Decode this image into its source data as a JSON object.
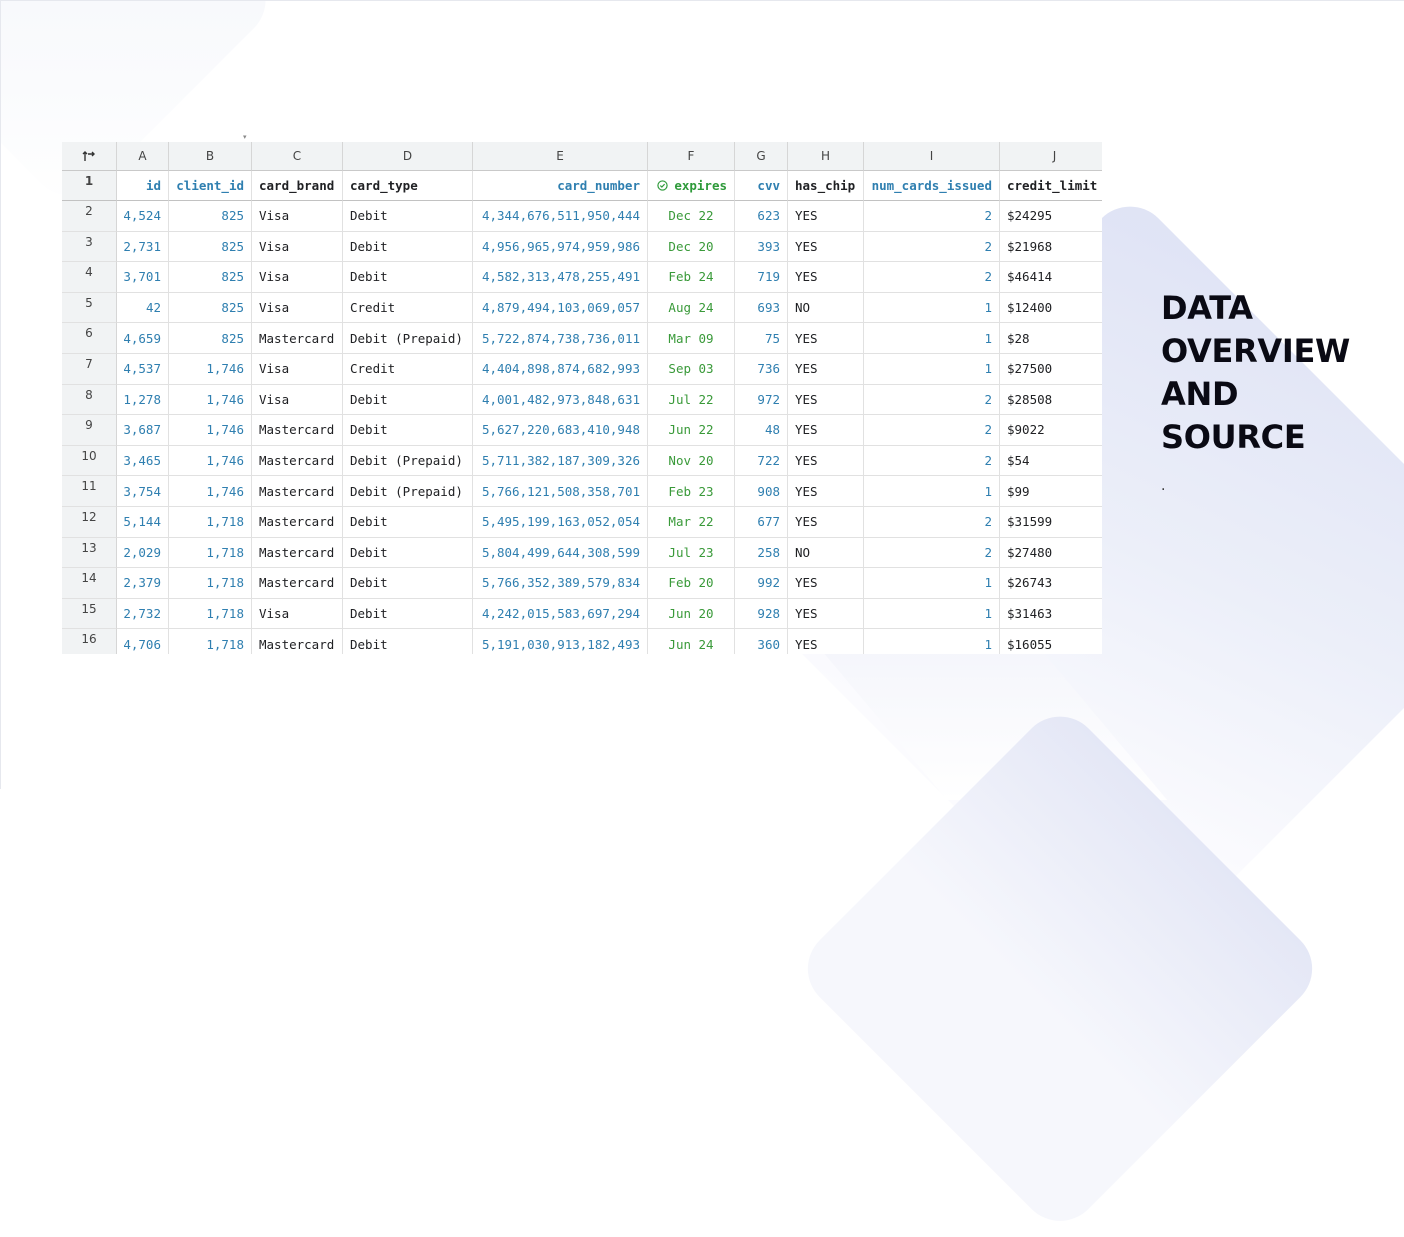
{
  "slide": {
    "title_lines": [
      "DATA",
      "OVERVIEW",
      "AND",
      "SOURCE"
    ],
    "subtitle": "."
  },
  "sheet": {
    "column_letters": [
      "A",
      "B",
      "C",
      "D",
      "E",
      "F",
      "G",
      "H",
      "I",
      "J"
    ],
    "field_names": [
      "id",
      "client_id",
      "card_brand",
      "card_type",
      "card_number",
      "expires",
      "cvv",
      "has_chip",
      "num_cards_issued",
      "credit_limit"
    ],
    "expires_icon": "clock-check-icon",
    "colors": {
      "number": "#2f7fb0",
      "date": "#3a9a3a",
      "text": "#202124",
      "header_bg": "#f1f3f4"
    },
    "rows": [
      {
        "n": "2",
        "id": "4,524",
        "client_id": "825",
        "card_brand": "Visa",
        "card_type": "Debit",
        "card_number": "4,344,676,511,950,444",
        "expires": "Dec 22",
        "cvv": "623",
        "has_chip": "YES",
        "num_cards_issued": "2",
        "credit_limit": "$24295"
      },
      {
        "n": "3",
        "id": "2,731",
        "client_id": "825",
        "card_brand": "Visa",
        "card_type": "Debit",
        "card_number": "4,956,965,974,959,986",
        "expires": "Dec 20",
        "cvv": "393",
        "has_chip": "YES",
        "num_cards_issued": "2",
        "credit_limit": "$21968"
      },
      {
        "n": "4",
        "id": "3,701",
        "client_id": "825",
        "card_brand": "Visa",
        "card_type": "Debit",
        "card_number": "4,582,313,478,255,491",
        "expires": "Feb 24",
        "cvv": "719",
        "has_chip": "YES",
        "num_cards_issued": "2",
        "credit_limit": "$46414"
      },
      {
        "n": "5",
        "id": "42",
        "client_id": "825",
        "card_brand": "Visa",
        "card_type": "Credit",
        "card_number": "4,879,494,103,069,057",
        "expires": "Aug 24",
        "cvv": "693",
        "has_chip": "NO",
        "num_cards_issued": "1",
        "credit_limit": "$12400"
      },
      {
        "n": "6",
        "id": "4,659",
        "client_id": "825",
        "card_brand": "Mastercard",
        "card_type": "Debit (Prepaid)",
        "card_number": "5,722,874,738,736,011",
        "expires": "Mar 09",
        "cvv": "75",
        "has_chip": "YES",
        "num_cards_issued": "1",
        "credit_limit": "$28"
      },
      {
        "n": "7",
        "id": "4,537",
        "client_id": "1,746",
        "card_brand": "Visa",
        "card_type": "Credit",
        "card_number": "4,404,898,874,682,993",
        "expires": "Sep 03",
        "cvv": "736",
        "has_chip": "YES",
        "num_cards_issued": "1",
        "credit_limit": "$27500"
      },
      {
        "n": "8",
        "id": "1,278",
        "client_id": "1,746",
        "card_brand": "Visa",
        "card_type": "Debit",
        "card_number": "4,001,482,973,848,631",
        "expires": "Jul 22",
        "cvv": "972",
        "has_chip": "YES",
        "num_cards_issued": "2",
        "credit_limit": "$28508"
      },
      {
        "n": "9",
        "id": "3,687",
        "client_id": "1,746",
        "card_brand": "Mastercard",
        "card_type": "Debit",
        "card_number": "5,627,220,683,410,948",
        "expires": "Jun 22",
        "cvv": "48",
        "has_chip": "YES",
        "num_cards_issued": "2",
        "credit_limit": "$9022"
      },
      {
        "n": "10",
        "id": "3,465",
        "client_id": "1,746",
        "card_brand": "Mastercard",
        "card_type": "Debit (Prepaid)",
        "card_number": "5,711,382,187,309,326",
        "expires": "Nov 20",
        "cvv": "722",
        "has_chip": "YES",
        "num_cards_issued": "2",
        "credit_limit": "$54"
      },
      {
        "n": "11",
        "id": "3,754",
        "client_id": "1,746",
        "card_brand": "Mastercard",
        "card_type": "Debit (Prepaid)",
        "card_number": "5,766,121,508,358,701",
        "expires": "Feb 23",
        "cvv": "908",
        "has_chip": "YES",
        "num_cards_issued": "1",
        "credit_limit": "$99"
      },
      {
        "n": "12",
        "id": "5,144",
        "client_id": "1,718",
        "card_brand": "Mastercard",
        "card_type": "Debit",
        "card_number": "5,495,199,163,052,054",
        "expires": "Mar 22",
        "cvv": "677",
        "has_chip": "YES",
        "num_cards_issued": "2",
        "credit_limit": "$31599"
      },
      {
        "n": "13",
        "id": "2,029",
        "client_id": "1,718",
        "card_brand": "Mastercard",
        "card_type": "Debit",
        "card_number": "5,804,499,644,308,599",
        "expires": "Jul 23",
        "cvv": "258",
        "has_chip": "NO",
        "num_cards_issued": "2",
        "credit_limit": "$27480"
      },
      {
        "n": "14",
        "id": "2,379",
        "client_id": "1,718",
        "card_brand": "Mastercard",
        "card_type": "Debit",
        "card_number": "5,766,352,389,579,834",
        "expires": "Feb 20",
        "cvv": "992",
        "has_chip": "YES",
        "num_cards_issued": "1",
        "credit_limit": "$26743"
      },
      {
        "n": "15",
        "id": "2,732",
        "client_id": "1,718",
        "card_brand": "Visa",
        "card_type": "Debit",
        "card_number": "4,242,015,583,697,294",
        "expires": "Jun 20",
        "cvv": "928",
        "has_chip": "YES",
        "num_cards_issued": "1",
        "credit_limit": "$31463"
      },
      {
        "n": "16",
        "id": "4,706",
        "client_id": "1,718",
        "card_brand": "Mastercard",
        "card_type": "Debit",
        "card_number": "5,191,030,913,182,493",
        "expires": "Jun 24",
        "cvv": "360",
        "has_chip": "YES",
        "num_cards_issued": "1",
        "credit_limit": "$16055"
      }
    ]
  }
}
